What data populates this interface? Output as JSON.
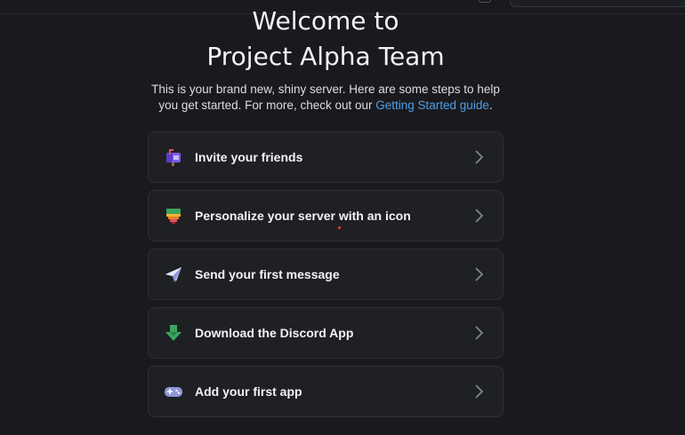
{
  "header": {
    "title_line1": "Welcome to",
    "title_line2": "Project Alpha Team",
    "description_text": "This is your brand new, shiny server. Here are some steps to help you get started. For more, check out our ",
    "description_link": "Getting Started guide",
    "description_end": "."
  },
  "steps": [
    {
      "label": "Invite your friends",
      "icon": "mailbox-icon"
    },
    {
      "label": "Personalize your server with an icon",
      "icon": "paint-brush-icon"
    },
    {
      "label": "Send your first message",
      "icon": "paper-plane-icon"
    },
    {
      "label": "Download the Discord App",
      "icon": "download-arrow-icon"
    },
    {
      "label": "Add your first app",
      "icon": "gamepad-icon"
    }
  ],
  "colors": {
    "background": "#1a1a1e",
    "card": "#1f2024",
    "link": "#4e9ee8",
    "accent_purple": "#7b5cf0",
    "accent_green": "#3ba55d"
  }
}
